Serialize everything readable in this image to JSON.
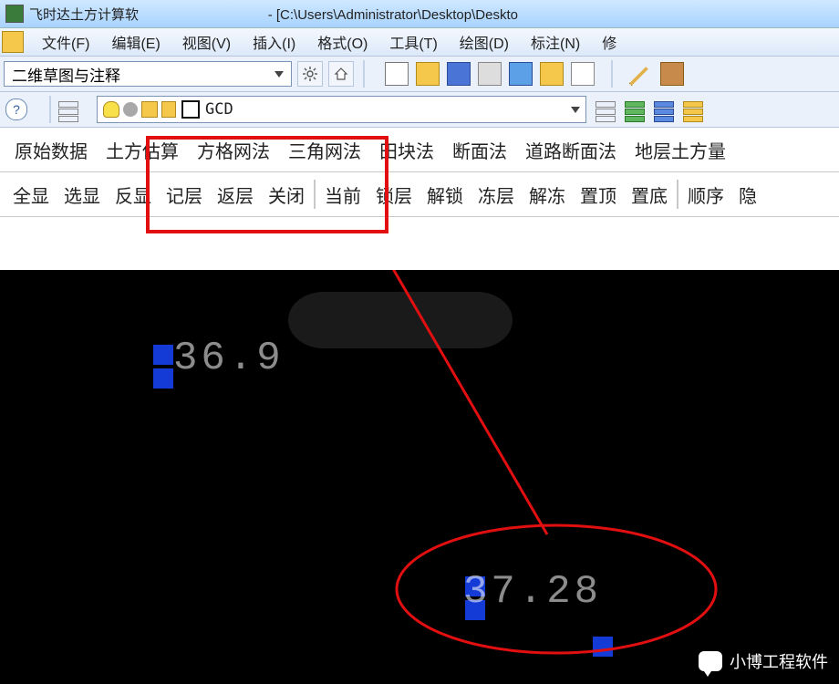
{
  "title": {
    "app_name": "飞时达土方计算软",
    "path": "- [C:\\Users\\Administrator\\Desktop\\Deskto"
  },
  "menubar": {
    "file": "文件(F)",
    "edit": "编辑(E)",
    "view": "视图(V)",
    "insert": "插入(I)",
    "format": "格式(O)",
    "tools": "工具(T)",
    "draw": "绘图(D)",
    "annotate": "标注(N)",
    "modify": "修"
  },
  "workspace_combo": "二维草图与注释",
  "layer": {
    "name": "GCD"
  },
  "row3": {
    "i0": "原始数据",
    "i1": "土方估算",
    "i2": "方格网法",
    "i3": "三角网法",
    "i4": "田块法",
    "i5": "断面法",
    "i6": "道路断面法",
    "i7": "地层土方量"
  },
  "row4": {
    "i0": "全显",
    "i1": "选显",
    "i2": "反显",
    "i3": "记层",
    "i4": "返层",
    "i5": "关闭",
    "i6": "当前",
    "i7": "锁层",
    "i8": "解锁",
    "i9": "冻层",
    "i10": "解冻",
    "i11": "置顶",
    "i12": "置底",
    "i13": "顺序",
    "i14": "隐"
  },
  "canvas": {
    "num_a": "36.9",
    "num_b": "37.28"
  },
  "watermark": "小博工程软件"
}
